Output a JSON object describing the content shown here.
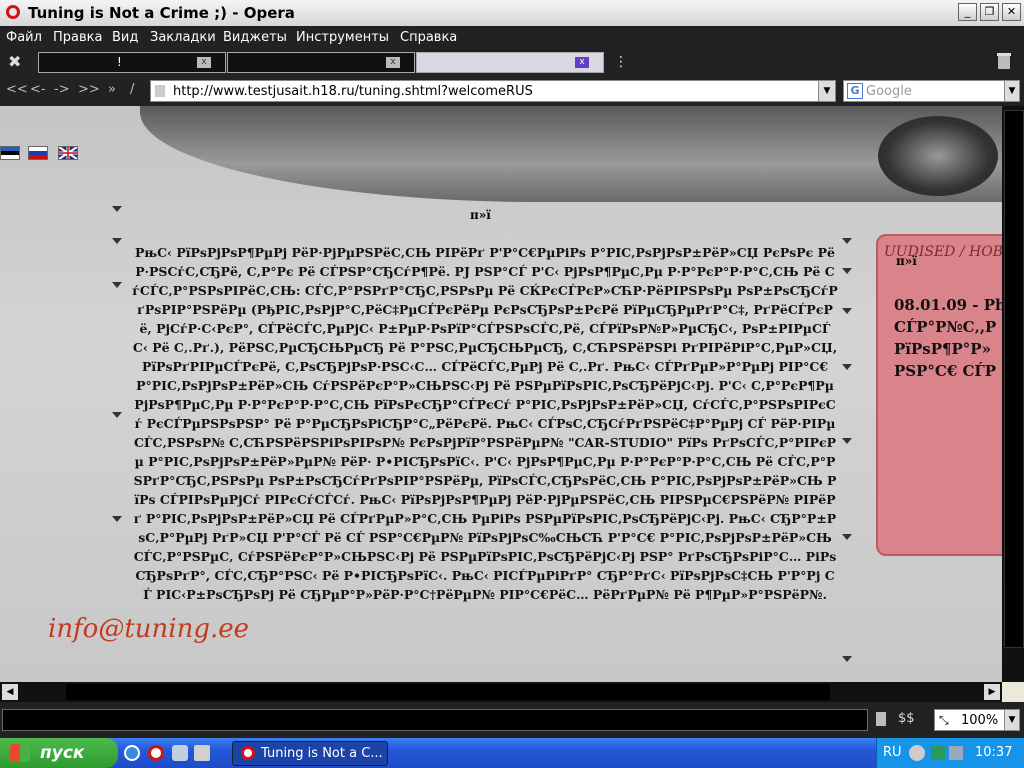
{
  "window": {
    "title": "Tuning is Not a Crime ;) - Opera",
    "controls": [
      "_",
      "❐",
      "✕"
    ]
  },
  "menu": {
    "items": [
      "Файл",
      "Правка",
      "Вид",
      "Закладки",
      "Виджеты",
      "Инструменты",
      "Справка"
    ]
  },
  "tabs": [
    {
      "label": "!",
      "close": "x",
      "active": false
    },
    {
      "label": "",
      "close": "x",
      "active": false
    },
    {
      "label": "",
      "close": "x",
      "active": true
    }
  ],
  "toolbar": {
    "more_label": "⋮",
    "trash_icon": "trash-icon",
    "tools_icon": "tools-icon"
  },
  "nav": {
    "rewind": "<<",
    "back": "<-",
    "forward": "->",
    "fastforward": ">>",
    "home": "»",
    "edit": "/"
  },
  "address": {
    "url": "http://www.testjusait.h18.ru/tuning.shtml?welcomeRUS"
  },
  "search": {
    "engine_letter": "G",
    "placeholder": "Google"
  },
  "page": {
    "top_mark": "п»ї",
    "main_text": "РњС‹ РїРѕРјРѕР¶РµРј РёР·РјРµРЅРёС‚СЊ РІРёРґ Р'Р°С€РµРіРѕ Р°РІС‚РѕРјРѕР±РёР»СЏ РєРѕРє РёР·РЅСѓС‚СЂРё, С‚Р°Рє Рё СЃРЅР°СЂСѓР¶Рё. РЈ РЅР°СЃ Р'С‹ РјРѕР¶РµС‚Рµ Р·Р°РєР°Р·Р°С‚СЊ Рё СѓСЃС‚Р°РЅРѕРІРёС‚СЊ: СЃС‚Р°РЅРґР°СЂС‚РЅРѕРµ Рё СЌРєСЃРєР»СЋР·РёРІРЅРѕРµ РѕР±РѕСЂСѓРґРѕРІР°РЅРёРµ (РђРІС‚РѕРјР°С‚РёС‡РµСЃРєРёРµ РєРѕСЂРѕР±РєРё РїРµСЂРµРґР°С‡, РґРёСЃРєРё, РјСѓР·С‹РєР°, СЃРёСЃС‚РµРјС‹ Р±РµР·РѕРїР°СЃРЅРѕСЃС‚Рё, СЃРїРѕР№Р»РµСЂС‹, РѕР±РІРµСЃС‹ Рё С‚.Рґ.), РёРЅС‚РµСЂСЊРµСЂ Рё Р°РЅС‚РµСЂСЊРµСЂ, С‚СЋРЅРёРЅРі РґРІРёРіР°С‚РµР»СЏ, РїРѕРґРІРµСЃРєРё, С‚РѕСЂРјРѕР·РЅС‹С… СЃРёСЃС‚РµРј Рё С‚.Рґ. РњС‹ СЃРґРµР»Р°РµРј РІР°С€ Р°РІС‚РѕРјРѕР±РёР»СЊ СѓРЅРёРєР°Р»СЊРЅС‹Рј Рё РЅРµРїРѕРІС‚РѕСЂРёРјС‹Рј. Р'С‹ С‚Р°РєР¶Рµ РјРѕР¶РµС‚Рµ Р·Р°РєР°Р·Р°С‚СЊ РїРѕРєСЂР°СЃРєСѓ Р°РІС‚РѕРјРѕР±РёР»СЏ, СѓСЃС‚Р°РЅРѕРІРєСѓ РєСЃРµРЅРѕРЅР° Рё Р°РµСЂРѕРіСЂР°С„РёРєРё. РњС‹ СЃРѕС‚СЂСѓРґРЅРёС‡Р°РµРј СЃ РёР·РІРµСЃС‚РЅРѕР№ С‚СЋРЅРёРЅРіРѕРІРѕР№ РєРѕРјРїР°РЅРёРµР№ \"CAR-STUDIO\" РїРѕ РґРѕСЃС‚Р°РІРєРµ Р°РІС‚РѕРјРѕР±РёР»РµР№ РёР· Р•РІСЂРѕРїС‹. Р'С‹ РјРѕР¶РµС‚Рµ Р·Р°РєР°Р·Р°С‚СЊ Рё СЃС‚Р°РЅРґР°СЂС‚РЅРѕРµ РѕР±РѕСЂСѓРґРѕРІР°РЅРёРµ, РїРѕСЃС‚СЂРѕРёС‚СЊ Р°РІС‚РѕРјРѕР±РёР»СЊ РїРѕ СЃРІРѕРµРјСѓ РІРєСѓСЃСѓ. РњС‹ РїРѕРјРѕР¶РµРј РёР·РјРµРЅРёС‚СЊ РІРЅРµС€РЅРёР№ РІРёРґ Р°РІС‚РѕРјРѕР±РёР»СЏ Рё СЃРґРµР»Р°С‚СЊ РµРіРѕ РЅРµРїРѕРІС‚РѕСЂРёРјС‹Рј. РњС‹ СЂР°Р±РѕС‚Р°РµРј РґР»СЏ Р'Р°СЃ Рё СЃ РЅР°С€РµР№ РїРѕРјРѕС‰СЊСЋ Р'Р°С€ Р°РІС‚РѕРјРѕР±РёР»СЊ СЃС‚Р°РЅРµС‚ СѓРЅРёРєР°Р»СЊРЅС‹Рј Рё РЅРµРїРѕРІС‚РѕСЂРёРјС‹Рј РЅР° РґРѕСЂРѕРіР°С… РіРѕСЂРѕРґР°, СЃС‚СЂР°РЅС‹ Рё Р•РІСЂРѕРїС‹. РњС‹ РІСЃРµРіРґР° СЂР°РґС‹ РїРѕРјРѕС‡СЊ Р'Р°Рј СЃ РІС‹Р±РѕСЂРѕРј Рё СЂРµР°Р»РёР·Р°С†РёРµР№ РІР°С€РёС… РёРґРµР№ Рё Р¶РµР»Р°РЅРёР№.",
    "email": "info@tuning.ee",
    "sidebox": {
      "heading": "UUDISED / НОВОСТИ",
      "mark": "п»ї",
      "news": [
        "08.01.09 - Ph",
        "СЃР°Р№С‚,Р",
        "РїРѕР¶Р°Р»",
        "РЅР°С€ СЃР"
      ]
    }
  },
  "scroll": {
    "up": "▲",
    "down": "▼",
    "left": "◀",
    "right": "▶"
  },
  "status": {
    "zoom": "100%",
    "view_toggle": "$$"
  },
  "taskbar": {
    "start_label": "пуск",
    "task_label": "Tuning is Not a C...",
    "lang": "RU",
    "clock": "10:37"
  }
}
